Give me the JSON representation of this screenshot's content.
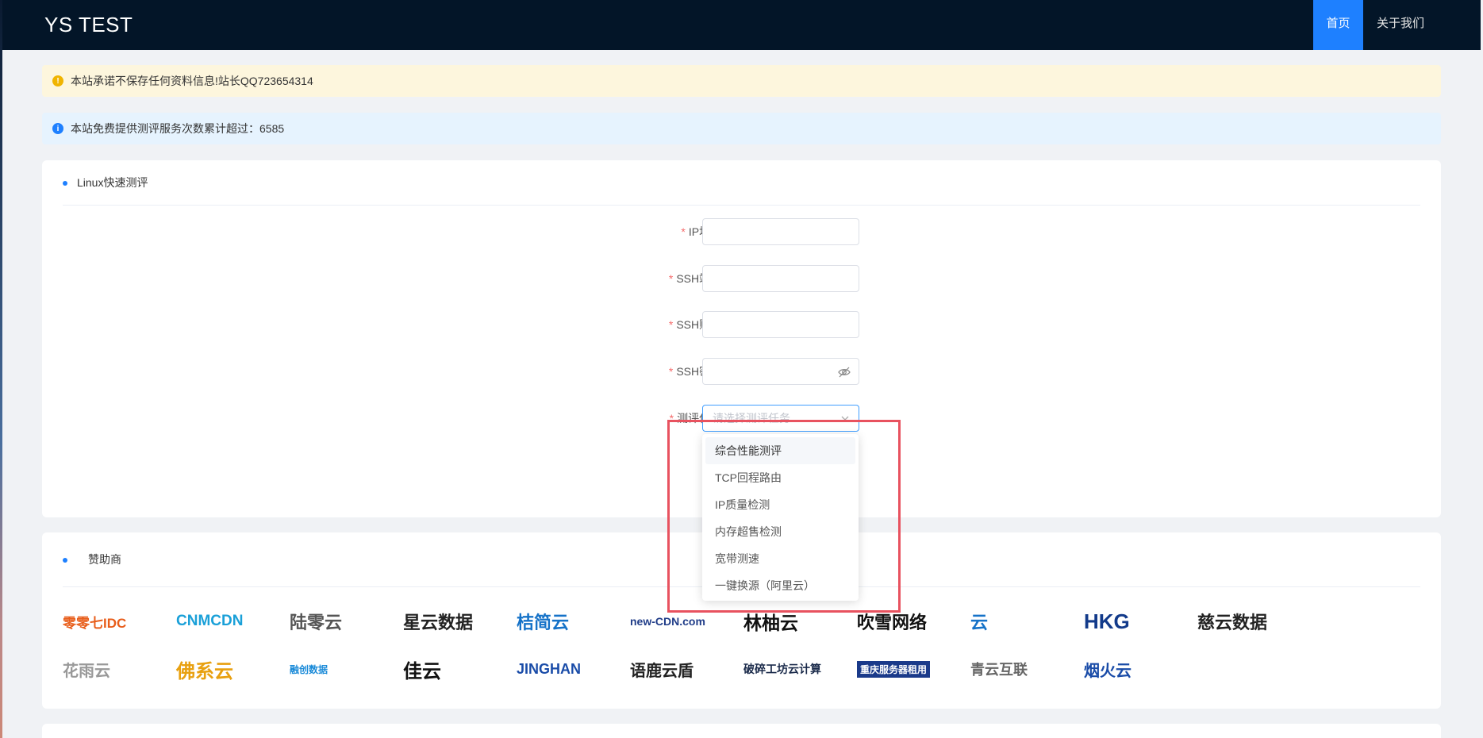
{
  "header": {
    "brand": "YS TEST",
    "nav": [
      "首页",
      "关于我们"
    ]
  },
  "alerts": {
    "warning": "本站承诺不保存任何资料信息!站长QQ723654314",
    "info": "本站免费提供测评服务次数累计超过：6585"
  },
  "test_card": {
    "title": "Linux快速测评",
    "fields": {
      "ip": "IP地址:",
      "port": "SSH端口:",
      "account": "SSH账号:",
      "password": "SSH密码:",
      "task": "测评任务:"
    },
    "task_placeholder": "请选择测评任务",
    "task_options": [
      "综合性能测评",
      "TCP回程路由",
      "IP质量检测",
      "内存超售检测",
      "宽带测速",
      "一键换源（阿里云）"
    ]
  },
  "sponsor_card": {
    "title": "赞助商",
    "row1": [
      "零零七IDC",
      "CNMCDN",
      "陆零云",
      "星云数据",
      "桔简云",
      "new-CDN.com",
      "林柚云",
      "吹雪网络",
      "云",
      "HKG",
      "慈云数据"
    ],
    "row2": [
      "花雨云",
      "佛系云",
      "融创数据",
      "佳云",
      "JINGHAN",
      "语鹿云盾",
      "破碎工坊云计算",
      "重庆服务器租用",
      "青云互联",
      "烟火云"
    ],
    "colors": {
      "accent": "#1e80ff",
      "topbar": "#031528",
      "highlight": "#e8525f"
    }
  }
}
